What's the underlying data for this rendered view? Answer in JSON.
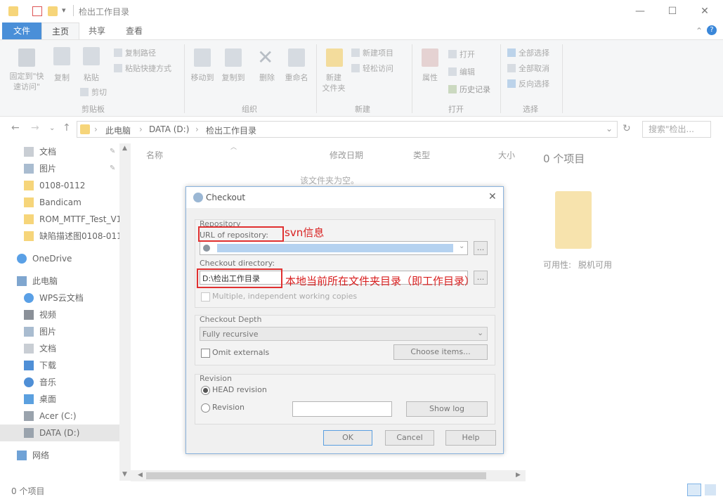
{
  "window": {
    "title": "检出工作目录",
    "qat_arrow": "▾",
    "controls": {
      "minimize": "—",
      "maximize": "☐",
      "close": "✕"
    }
  },
  "ribbon": {
    "tabs": [
      "文件",
      "主页",
      "共享",
      "查看"
    ],
    "help": "?",
    "expand": "⌃",
    "clipboard": {
      "pin": "固定到\"快\n速访问\"",
      "copy": "复制",
      "paste": "粘贴",
      "copy_path": "复制路径",
      "paste_shortcut": "粘贴快捷方式",
      "cut": "剪切",
      "group": "剪贴板"
    },
    "organize": {
      "move_to": "移动到",
      "copy_to": "复制到",
      "delete": "删除",
      "rename": "重命名",
      "group": "组织"
    },
    "new": {
      "new_folder": "新建\n文件夹",
      "new_item": "新建项目",
      "easy_access": "轻松访问",
      "group": "新建"
    },
    "open": {
      "properties": "属性",
      "open": "打开",
      "edit": "编辑",
      "history": "历史记录",
      "group": "打开"
    },
    "select": {
      "select_all": "全部选择",
      "select_none": "全部取消",
      "invert": "反向选择",
      "group": "选择"
    }
  },
  "address": {
    "path": [
      "此电脑",
      "DATA (D:)",
      "检出工作目录"
    ],
    "search_placeholder": "搜索\"检出..."
  },
  "sidebar": {
    "items": [
      {
        "label": "文档",
        "icon": "document-icon",
        "pinned": true
      },
      {
        "label": "图片",
        "icon": "picture-icon",
        "pinned": true
      },
      {
        "label": "0108-0112",
        "icon": "folder-icon"
      },
      {
        "label": "Bandicam",
        "icon": "folder-icon"
      },
      {
        "label": "ROM_MTTF_Test_V1",
        "icon": "folder-icon"
      },
      {
        "label": "缺陷描述图0108-011",
        "icon": "folder-icon"
      },
      {
        "label": "OneDrive",
        "icon": "cloud-icon"
      },
      {
        "label": "此电脑",
        "icon": "computer-icon"
      },
      {
        "label": "WPS云文档",
        "icon": "cloud-icon"
      },
      {
        "label": "视频",
        "icon": "video-icon"
      },
      {
        "label": "图片",
        "icon": "picture-icon"
      },
      {
        "label": "文档",
        "icon": "document-icon"
      },
      {
        "label": "下载",
        "icon": "download-icon"
      },
      {
        "label": "音乐",
        "icon": "music-icon"
      },
      {
        "label": "桌面",
        "icon": "desktop-icon"
      },
      {
        "label": "Acer (C:)",
        "icon": "drive-icon"
      },
      {
        "label": "DATA (D:)",
        "icon": "drive-icon",
        "selected": true
      },
      {
        "label": "网络",
        "icon": "network-icon"
      }
    ]
  },
  "filelist": {
    "columns": [
      "名称",
      "修改日期",
      "类型",
      "大小"
    ],
    "empty_text": "该文件夹为空。"
  },
  "details": {
    "count": "0 个项目",
    "availability_label": "可用性:",
    "availability_value": "脱机可用"
  },
  "status": {
    "count": "0 个项目"
  },
  "dialog": {
    "title": "Checkout",
    "repository_group": "Repository",
    "url_label": "URL of repository:",
    "browse": "...",
    "dir_label": "Checkout directory:",
    "dir_value": "D:\\检出工作目录",
    "multiple_label": "Multiple, independent working copies",
    "depth_group": "Checkout Depth",
    "depth_value": "Fully recursive",
    "omit_label": "Omit externals",
    "choose_items": "Choose items...",
    "revision_group": "Revision",
    "head_label": "HEAD revision",
    "revision_label": "Revision",
    "show_log": "Show log",
    "ok": "OK",
    "cancel": "Cancel",
    "help": "Help"
  },
  "annotations": {
    "url_note": "svn信息",
    "dir_note": "本地当前所在文件夹目录（即工作目录）",
    "color": "#e03030"
  }
}
